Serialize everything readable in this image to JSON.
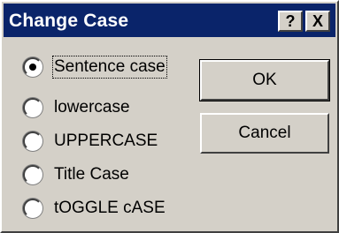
{
  "window": {
    "title": "Change Case",
    "help_label": "?",
    "close_label": "X"
  },
  "options": [
    {
      "label": "Sentence case",
      "checked": true
    },
    {
      "label": "lowercase",
      "checked": false
    },
    {
      "label": "UPPERCASE",
      "checked": false
    },
    {
      "label": "Title Case",
      "checked": false
    },
    {
      "label": "tOGGLE cASE",
      "checked": false
    }
  ],
  "buttons": {
    "ok_label": "OK",
    "cancel_label": "Cancel"
  },
  "colors": {
    "titlebar": "#0a246a",
    "face": "#d4d0c8"
  }
}
